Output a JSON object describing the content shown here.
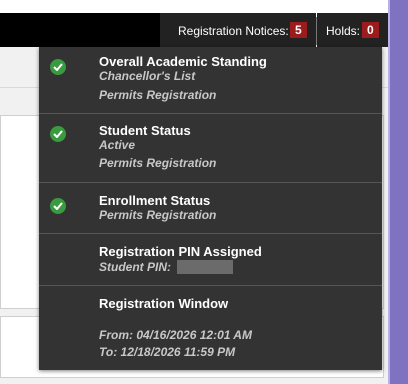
{
  "header": {
    "registration_notices_label": "Registration Notices:",
    "registration_notices_count": "5",
    "holds_label": "Holds:",
    "holds_count": "0"
  },
  "menu": {
    "items": [
      {
        "title": "Overall Academic Standing",
        "lines": [
          "Chancellor's List",
          "Permits Registration"
        ],
        "status": "check"
      },
      {
        "title": "Student Status",
        "lines": [
          "Active",
          "Permits Registration"
        ],
        "status": "check"
      },
      {
        "title": "Enrollment Status",
        "lines": [
          "Permits Registration"
        ],
        "status": "check"
      },
      {
        "title": "Registration PIN Assigned",
        "lines": [
          "Student PIN:"
        ],
        "status": "none"
      },
      {
        "title": "Registration Window",
        "lines": [
          "From: 04/16/2026 12:01 AM",
          "To: 12/18/2026 11:59 PM"
        ],
        "status": "none"
      }
    ]
  },
  "colors": {
    "badge": "#9b1c1c",
    "check": "#3a9a3f",
    "dropdown_bg": "#333333"
  }
}
